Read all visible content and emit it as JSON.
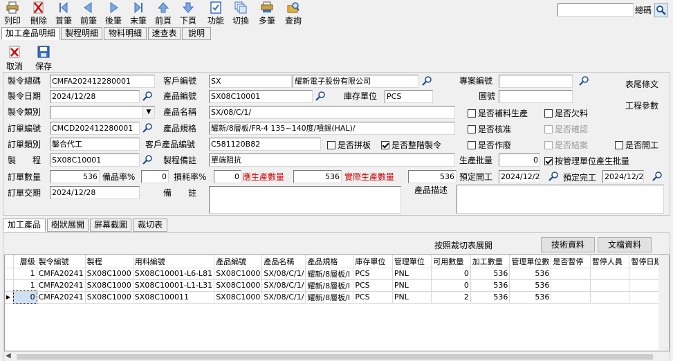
{
  "toolbar": {
    "print": "列印",
    "delete": "刪除",
    "first": "首筆",
    "prev": "前筆",
    "next": "後筆",
    "last": "末筆",
    "prev_page": "前頁",
    "next_page": "下頁",
    "function": "功能",
    "switch": "切換",
    "multi": "多筆",
    "query": "查詢"
  },
  "search": {
    "label": "總碼",
    "value": ""
  },
  "tabs": [
    "加工產品明細",
    "製程明細",
    "物料明細",
    "速查表",
    "說明"
  ],
  "actions": {
    "cancel": "取消",
    "save": "保存"
  },
  "form": {
    "order_no_label": "製令總碼",
    "order_no": "CMFA202412280001",
    "order_date_label": "製令日期",
    "order_date": "2024/12/28",
    "order_type_label": "製令類別",
    "order_type": "",
    "sales_no_label": "訂單編號",
    "sales_no": "CMCD202412280001",
    "sales_type_label": "訂單類別",
    "sales_type": "鑿合代工",
    "process_label": "製　　程",
    "process": "SX08C10001",
    "order_qty_label": "訂單數量",
    "order_qty": "536",
    "spare_rate_label": "備品率%",
    "spare_rate": "0",
    "loss_rate_label": "損耗率%",
    "loss_rate": "0",
    "due_date_label": "訂單交期",
    "due_date": "2024/12/28",
    "customer_no_label": "客戶編號",
    "customer_no": "SX",
    "customer_name": "耀新電子股份有限公司",
    "product_no_label": "產品編號",
    "product_no": "SX08C10001",
    "stock_unit_label": "庫存單位",
    "stock_unit": "PCS",
    "product_name_label": "產品名稱",
    "product_name": "SX/08/C/1/",
    "product_spec_label": "產品規格",
    "product_spec": "耀新/8層板/FR-4 135~140度/噴錫(HAL)/",
    "cust_product_no_label": "客戶產品編號",
    "cust_product_no": "C581120B82",
    "process_note_label": "製程備註",
    "process_note": "單端阻抗",
    "should_qty_label": "應生產數量",
    "should_qty": "536",
    "actual_qty_label": "實際生產數量",
    "actual_qty": "536",
    "remark_label": "備　　註",
    "remark": "",
    "project_no_label": "專案編號",
    "project_no": "",
    "drawing_no_label": "圖號",
    "drawing_no": "",
    "batch_label": "生產批量",
    "batch": "0",
    "plan_start_label": "預定開工",
    "plan_start": "2024/12/28",
    "plan_end_label": "預定完工",
    "plan_end": "2024/12/28",
    "product_desc_label": "產品描述",
    "product_desc": "",
    "footer_text": "表尾條文",
    "eng_params": "工程參數"
  },
  "checks": {
    "panel": "是否拼板",
    "whole": "是否整階製令",
    "supplement": "是否補料生產",
    "shortage": "是否欠料",
    "approve": "是否核准",
    "confirm": "是否確認",
    "void": "是否作廢",
    "close": "是否結案",
    "open": "是否開工",
    "mgmt_batch": "按管理單位產生批量"
  },
  "bottom_tabs": [
    "加工產品",
    "樹狀展開",
    "屏幕截圖",
    "裁切表"
  ],
  "expand_label": "按照裁切表展開",
  "tech_btn": "技術資料",
  "doc_btn": "文檔資料",
  "grid": {
    "headers": [
      "層級",
      "製令編號",
      "製程",
      "用料編號",
      "產品編號",
      "產品名稱",
      "產品規格",
      "庫存單位",
      "管理單位",
      "可用數量",
      "加工數量",
      "管理單位數",
      "是否暫停",
      "暫停人員",
      "暫停日期"
    ],
    "rows": [
      [
        "1",
        "CMFA20241",
        "SX08C1000",
        "SX08C10001-L6-L81",
        "SX08C1000",
        "SX/08/C/1/",
        "耀新/8層板/I",
        "PCS",
        "PNL",
        "0",
        "536",
        "536",
        "",
        "",
        ""
      ],
      [
        "1",
        "CMFA20241",
        "SX08C1000",
        "SX08C10001-L1-L31",
        "SX08C1000",
        "SX/08/C/1/",
        "耀新/8層板/I",
        "PCS",
        "PNL",
        "0",
        "536",
        "536",
        "",
        "",
        ""
      ],
      [
        "0",
        "CMFA20241",
        "SX08C1000",
        "SX08C100011",
        "SX08C1000",
        "SX/08/C/1/",
        "耀新/8層板/I",
        "PCS",
        "PNL",
        "2",
        "536",
        "536",
        "",
        "",
        ""
      ]
    ]
  }
}
